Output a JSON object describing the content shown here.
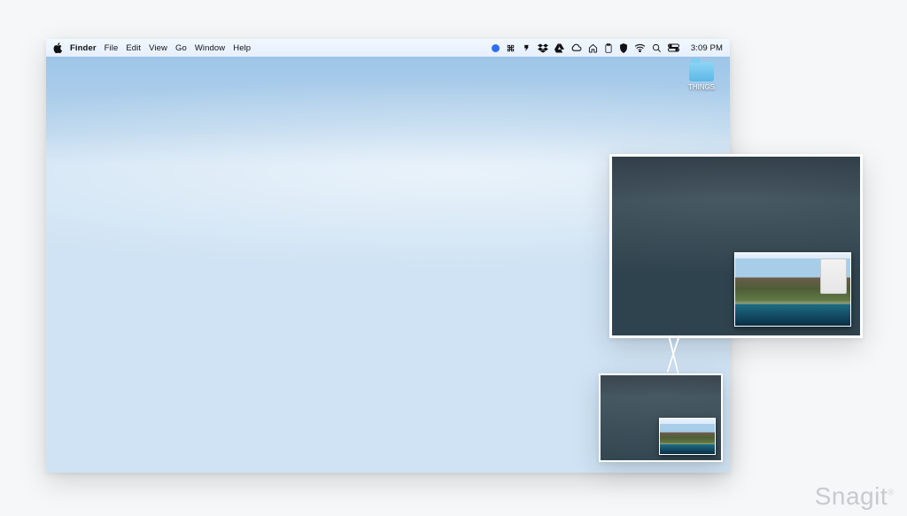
{
  "menubar": {
    "app": "Finder",
    "items": [
      "File",
      "Edit",
      "View",
      "Go",
      "Window",
      "Help"
    ],
    "clock": "3:09 PM"
  },
  "desktop": {
    "folder_label": "THINGS"
  },
  "status_icons": [
    "status-dot-icon",
    "puzzle-icon",
    "snagit-icon",
    "dropbox-icon",
    "google-drive-icon",
    "cloud-icon",
    "home-icon",
    "clipboard-icon",
    "shield-icon",
    "wifi-icon",
    "search-icon",
    "control-center-icon"
  ],
  "brand": {
    "name": "Snagit",
    "mark": "®"
  }
}
